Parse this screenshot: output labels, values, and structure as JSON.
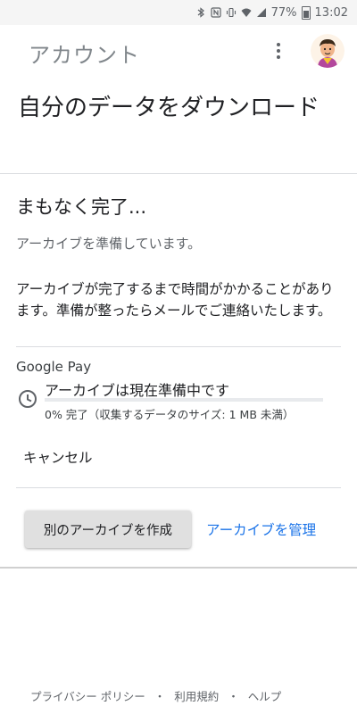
{
  "status_bar": {
    "battery": "77%",
    "time": "13:02",
    "icons": [
      "bluetooth-icon",
      "nfc-icon",
      "vibrate-icon",
      "wifi-icon",
      "signal-icon",
      "battery-icon"
    ]
  },
  "app_bar": {
    "title": "アカウント",
    "menu_icon": "more-vert-icon",
    "avatar": "avatar"
  },
  "page_title": "自分のデータをダウンロード",
  "card": {
    "heading": "まもなく完了...",
    "subtitle": "アーカイブを準備しています。",
    "description": "アーカイブが完了するまで時間がかかることがあります。準備が整ったらメールでご連絡いたします。",
    "service": "Google Pay",
    "status": "アーカイブは現在準備中です",
    "progress": 0,
    "progress_detail": "0% 完了（収集するデータのサイズ: 1 MB 未満）",
    "cancel_label": "キャンセル"
  },
  "actions": {
    "create_label": "別のアーカイブを作成",
    "manage_label": "アーカイブを管理"
  },
  "footer": {
    "privacy": "プライバシー ポリシー",
    "terms": "利用規約",
    "help": "ヘルプ",
    "separator": "・"
  },
  "colors": {
    "accent": "#1a73e8",
    "text": "#202124",
    "secondary_text": "#5f6368",
    "button_bg": "#e0e0e0"
  }
}
